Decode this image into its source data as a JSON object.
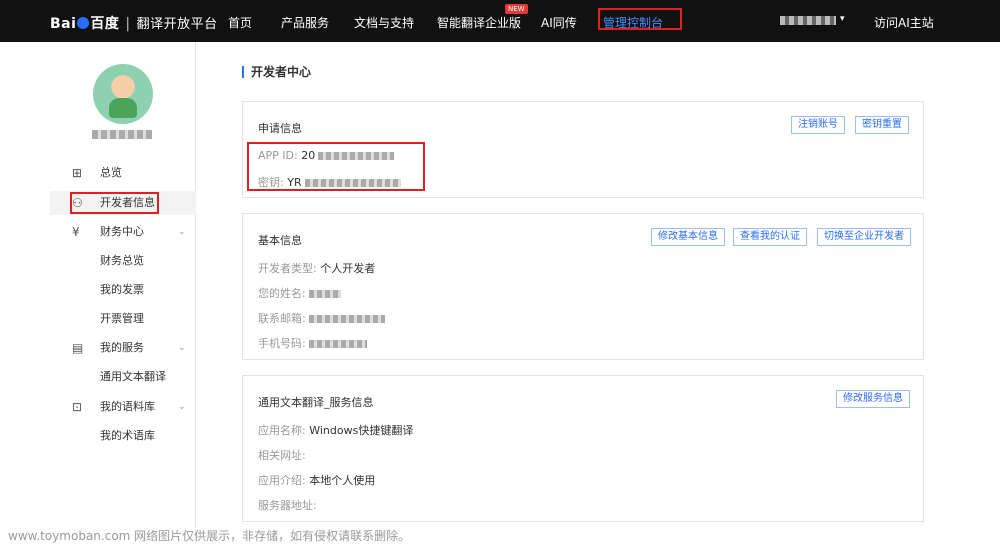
{
  "nav": {
    "logo_brand": "Bai",
    "logo_brand_cn": "百度",
    "logo_sep": "|",
    "logo_product": "翻译开放平台",
    "items": [
      {
        "label": "首页"
      },
      {
        "label": "产品服务"
      },
      {
        "label": "文档与支持"
      },
      {
        "label": "智能翻译企业版",
        "badge": "NEW"
      },
      {
        "label": "AI同传"
      },
      {
        "label": "管理控制台",
        "active": true
      }
    ],
    "caret": "▾",
    "visit_link": "访问AI主站"
  },
  "sidebar": {
    "menu": [
      {
        "icon": "grid-icon",
        "glyph": "⊞",
        "label": "总览"
      },
      {
        "icon": "user-icon",
        "glyph": "⚇",
        "label": "开发者信息",
        "active": true
      },
      {
        "icon": "yen-icon",
        "glyph": "¥",
        "label": "财务中心",
        "expandable": true
      },
      {
        "label": "财务总览",
        "sub": true
      },
      {
        "label": "我的发票",
        "sub": true
      },
      {
        "label": "开票管理",
        "sub": true
      },
      {
        "icon": "document-icon",
        "glyph": "▤",
        "label": "我的服务",
        "expandable": true
      },
      {
        "label": "通用文本翻译",
        "sub": true
      },
      {
        "icon": "box-icon",
        "glyph": "⊡",
        "label": "我的语料库",
        "expandable": true
      },
      {
        "label": "我的术语库",
        "sub": true
      }
    ],
    "chevron": "⌄"
  },
  "main": {
    "title": "开发者中心",
    "application": {
      "title": "申请信息",
      "buttons": [
        "注销账号",
        "密钥重置"
      ],
      "app_id_label": "APP ID:",
      "app_id_prefix": "20",
      "secret_label": "密钥:",
      "secret_prefix": "YR"
    },
    "basic": {
      "title": "基本信息",
      "buttons": [
        "修改基本信息",
        "查看我的认证",
        "切换至企业开发者"
      ],
      "rows": [
        {
          "label": "开发者类型:",
          "value": "个人开发者"
        },
        {
          "label": "您的姓名:",
          "value": ""
        },
        {
          "label": "联系邮箱:",
          "value": ""
        },
        {
          "label": "手机号码:",
          "value": ""
        }
      ]
    },
    "service": {
      "title": "通用文本翻译_服务信息",
      "buttons": [
        "修改服务信息"
      ],
      "rows": [
        {
          "label": "应用名称:",
          "value": "Windows快捷键翻译"
        },
        {
          "label": "相关网址:",
          "value": ""
        },
        {
          "label": "应用介绍:",
          "value": "本地个人使用"
        },
        {
          "label": "服务器地址:",
          "value": ""
        }
      ]
    }
  },
  "watermark": "www.toymoban.com 网络图片仅供展示，非存储，如有侵权请联系删除。",
  "colors": {
    "topbar": "#111111",
    "accent": "#2a6df4",
    "highlight": "#e02020"
  }
}
